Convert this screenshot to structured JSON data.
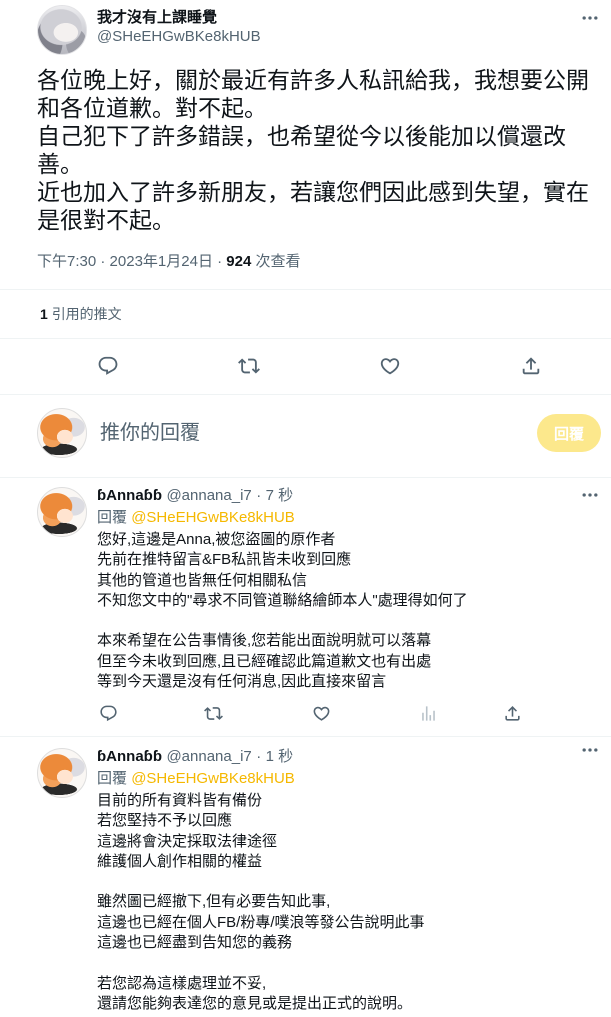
{
  "theme": {
    "text_color": "#0f1419",
    "muted_color": "#536471",
    "divider_color": "#eff3f4",
    "accent_color": "#f5b800",
    "reply_button_color": "#fce88c",
    "reply_button_text_color": "#ffffff"
  },
  "tweet": {
    "author": {
      "name": "我才沒有上課睡覺",
      "handle": "@SHeEHGwBKe8kHUB"
    },
    "text": "各位晚上好，關於最近有許多人私訊給我，我想要公開和各位道歉。對不起。\n自己犯下了許多錯誤，也希望從今以後能加以償還改善。\n近也加入了許多新朋友，若讓您們因此感到失望，實在是很對不起。",
    "time": "下午7:30",
    "separator": "·",
    "date": "2023年1月24日",
    "views_count": "924",
    "views_label": "次查看",
    "quotes_count": "1",
    "quotes_label": "引用的推文",
    "action_icons": [
      "reply-icon",
      "retweet-icon",
      "like-icon",
      "share-icon"
    ]
  },
  "composer": {
    "placeholder": "推你的回覆",
    "submit_label": "回覆"
  },
  "replies": [
    {
      "author_name": "ɓAnnaɓɓ",
      "handle": "@annana_i7",
      "separator": "·",
      "time": "7 秒",
      "reply_prefix": "回覆",
      "reply_to": "@SHeEHGwBKe8kHUB",
      "text": "您好,這邊是Anna,被您盜圖的原作者\n先前在推特留言&FB私訊皆未收到回應\n其他的管道也皆無任何相關私信\n不知您文中的\"尋求不同管道聯絡繪師本人\"處理得如何了\n\n本來希望在公告事情後,您若能出面說明就可以落幕\n但至今未收到回應,且已經確認此篇道歉文也有出處\n等到今天還是沒有任何消息,因此直接來留言",
      "action_icons": [
        "reply-icon",
        "retweet-icon",
        "like-icon",
        "analytics-icon",
        "share-icon"
      ]
    },
    {
      "author_name": "ɓAnnaɓɓ",
      "handle": "@annana_i7",
      "separator": "·",
      "time": "1 秒",
      "reply_prefix": "回覆",
      "reply_to": "@SHeEHGwBKe8kHUB",
      "text": "目前的所有資料皆有備份\n若您堅持不予以回應\n這邊將會決定採取法律途徑\n維護個人創作相關的權益\n\n雖然圖已經撤下,但有必要告知此事,\n這邊也已經在個人FB/粉專/噗浪等發公告說明此事\n這邊也已經盡到告知您的義務\n\n若您認為這樣處理並不妥,\n還請您能夠表達您的意見或是提出正式的說明。"
    }
  ]
}
